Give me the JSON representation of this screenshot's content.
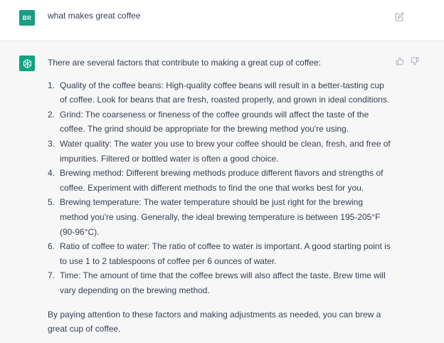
{
  "user_message": {
    "avatar_initials": "BR",
    "text": "what makes great coffee"
  },
  "assistant_message": {
    "intro": "There are several factors that contribute to making a great cup of coffee:",
    "items": [
      {
        "num": "1.",
        "text": "Quality of the coffee beans: High-quality coffee beans will result in a better-tasting cup of coffee. Look for beans that are fresh, roasted properly, and grown in ideal conditions."
      },
      {
        "num": "2.",
        "text": "Grind: The coarseness or fineness of the coffee grounds will affect the taste of the coffee. The grind should be appropriate for the brewing method you're using."
      },
      {
        "num": "3.",
        "text": "Water quality: The water you use to brew your coffee should be clean, fresh, and free of impurities. Filtered or bottled water is often a good choice."
      },
      {
        "num": "4.",
        "text": "Brewing method: Different brewing methods produce different flavors and strengths of coffee. Experiment with different methods to find the one that works best for you."
      },
      {
        "num": "5.",
        "text": "Brewing temperature: The water temperature should be just right for the brewing method you're using. Generally, the ideal brewing temperature is between 195-205°F (90-96°C)."
      },
      {
        "num": "6.",
        "text": "Ratio of coffee to water: The ratio of coffee to water is important. A good starting point is to use 1 to 2 tablespoons of coffee per 6 ounces of water."
      },
      {
        "num": "7.",
        "text": "Time: The amount of time that the coffee brews will also affect the taste. Brew time will vary depending on the brewing method."
      }
    ],
    "outro": "By paying attention to these factors and making adjustments as needed, you can brew a great cup of coffee."
  },
  "icons": {
    "edit": "edit-icon",
    "thumbs_up": "thumbs-up-icon",
    "thumbs_down": "thumbs-down-icon",
    "assistant_logo": "openai-logo-icon"
  },
  "colors": {
    "user_avatar": "#1a9e82",
    "assistant_avatar": "#10a37f",
    "assistant_bg": "#f7f7f8",
    "text": "#374151"
  }
}
